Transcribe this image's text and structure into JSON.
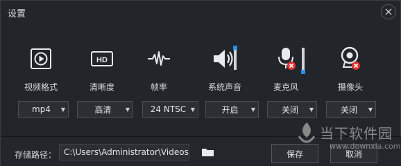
{
  "window": {
    "title": "设置"
  },
  "devices": [
    {
      "label": "视频格式",
      "icon": "video-format-icon"
    },
    {
      "label": "清晰度",
      "icon": "hd-icon"
    },
    {
      "label": "帧率",
      "icon": "frame-rate-icon"
    },
    {
      "label": "系统声音",
      "icon": "speaker-icon"
    },
    {
      "label": "麦克风",
      "icon": "microphone-off-icon"
    },
    {
      "label": "摄像头",
      "icon": "camera-off-icon"
    }
  ],
  "selects": [
    {
      "value": "mp4"
    },
    {
      "value": "高清"
    },
    {
      "value": "24 NTSC"
    },
    {
      "value": "开启"
    },
    {
      "value": "关闭"
    },
    {
      "value": "关闭"
    }
  ],
  "footer": {
    "path_label": "存储路径：",
    "path_value": "C:\\Users\\Administrator\\Videos",
    "save_label": "保存",
    "cancel_label": "取消"
  },
  "watermark": {
    "text": "当下软件园",
    "url": "www.downxia.com"
  },
  "colors": {
    "accent": "#2a8ee6",
    "badge_red": "#e0322f",
    "background": "#22262a"
  }
}
